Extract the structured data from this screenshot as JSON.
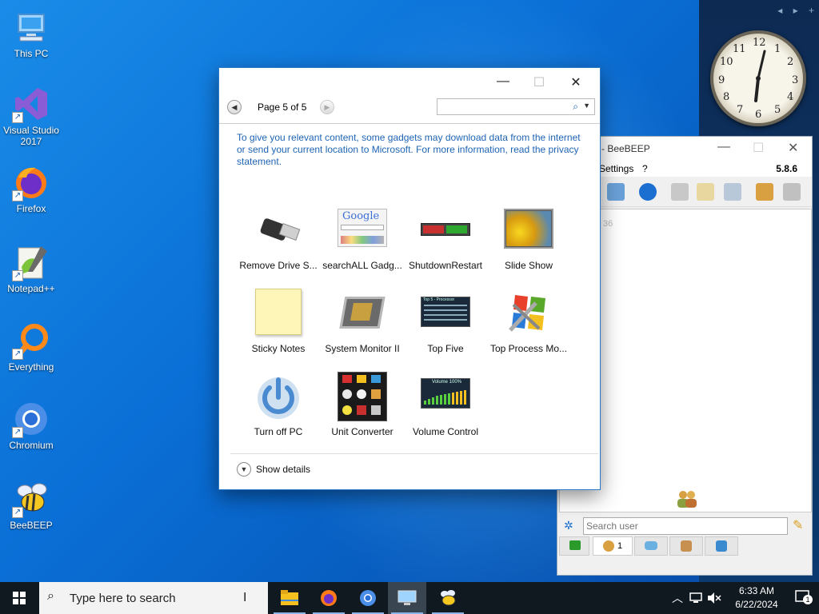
{
  "desktop": {
    "icons": [
      {
        "label": "This PC"
      },
      {
        "label": "Visual Studio 2017"
      },
      {
        "label": "Firefox"
      },
      {
        "label": "Notepad++"
      },
      {
        "label": "Everything"
      },
      {
        "label": "Chromium"
      },
      {
        "label": "BeeBEEP"
      }
    ]
  },
  "gallery": {
    "page_label": "Page 5 of 5",
    "search_placeholder": "",
    "privacy_text": "To give you relevant content, some gadgets may download data from the internet or send your current location to Microsoft. For more information, read the privacy statement.",
    "gadgets": [
      {
        "label": "Remove Drive S..."
      },
      {
        "label": "searchALL Gadg..."
      },
      {
        "label": "ShutdownRestart"
      },
      {
        "label": "Slide Show"
      },
      {
        "label": "Sticky Notes"
      },
      {
        "label": "System Monitor II"
      },
      {
        "label": "Top Five"
      },
      {
        "label": "Top Process Mo..."
      },
      {
        "label": "Turn off PC"
      },
      {
        "label": "Unit Converter"
      },
      {
        "label": "Volume Control"
      }
    ],
    "show_details": "Show details",
    "google_text": "Google",
    "topfive_title": "Top 5 - Processor",
    "volume_text": "Volume 100%"
  },
  "beebeep": {
    "title": "- BeeBEEP",
    "menu_settings": "Settings",
    "menu_help": "?",
    "version": "5.8.6",
    "faint_text": "36",
    "search_placeholder": "Search user",
    "users_count": "1"
  },
  "clock": {
    "numerals": [
      "12",
      "1",
      "2",
      "3",
      "4",
      "5",
      "6",
      "7",
      "8",
      "9",
      "10",
      "11"
    ]
  },
  "taskbar": {
    "search_placeholder": "Type here to search",
    "time": "6:33 AM",
    "date": "6/22/2024",
    "notification_count": "1"
  },
  "colors": {
    "accent": "#1e64b4",
    "taskbar": "#101820",
    "window_border": "#2a79c7"
  }
}
